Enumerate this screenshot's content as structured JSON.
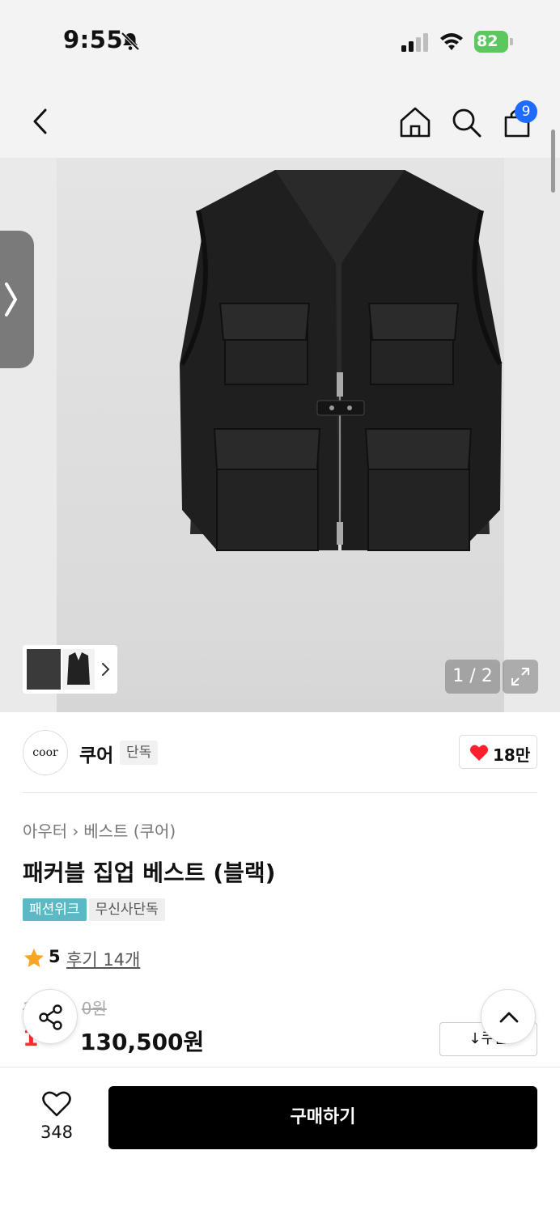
{
  "status_bar": {
    "time": "9:55",
    "battery_level": "82",
    "icons": [
      "bell-slash-icon",
      "signal-icon",
      "wifi-icon",
      "battery-charging-icon"
    ]
  },
  "nav": {
    "icons": [
      "back-icon",
      "home-icon",
      "search-icon",
      "cart-icon"
    ],
    "cart_count": "9"
  },
  "gallery": {
    "page_counter": "1 / 2",
    "image_subject": "black vest",
    "icons": [
      "chevron-right-icon",
      "expand-icon"
    ]
  },
  "brand": {
    "logo_text": "coor",
    "name": "쿠어",
    "badge": "단독",
    "like_count": "18만"
  },
  "product": {
    "breadcrumb": [
      "아우터",
      "베스트 (쿠어)"
    ],
    "title": "패커블 집업 베스트 (블랙)",
    "tags": [
      "패션위크",
      "무신사단독"
    ],
    "rating": "5",
    "review_link": "후기 14개",
    "original_price": "1",
    "original_price_tail": "0원",
    "discount_rate": "1",
    "sale_price": "130,500원",
    "coupon_label": "↓쿠폰"
  },
  "bottom_bar": {
    "wishlist_count": "348",
    "buy_label": "구매하기"
  },
  "colors": {
    "accent_red": "#ff2d2d",
    "badge_blue": "#1e6bff",
    "tag_teal": "#5bb8c4",
    "battery_green": "#5cc75f"
  }
}
